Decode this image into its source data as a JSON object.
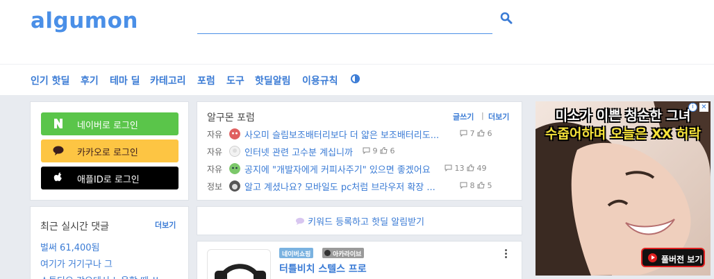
{
  "header": {
    "logo": "algumon",
    "search": {
      "placeholder": ""
    }
  },
  "nav": {
    "items": [
      "인기 핫딜",
      "후기",
      "테마 딜",
      "카테고리",
      "포럼",
      "도구",
      "핫딜알림",
      "이용규칙"
    ],
    "theme_toggle_icon": "contrast-icon"
  },
  "login": {
    "naver": {
      "label": "네이버로 로그인",
      "icon": "N",
      "color": "#5ac54a"
    },
    "kakao": {
      "label": "카카오로 로그인",
      "color": "#fdc543"
    },
    "apple": {
      "label": "애플ID로 로그인",
      "color": "#000000"
    }
  },
  "comments": {
    "title": "최근 실시간 댓글",
    "more": "더보기",
    "items": [
      "벌써 61,400됨",
      "여기가 거기구나 그"
    ]
  },
  "forum": {
    "title": "알구몬 포럼",
    "write": "글쓰기",
    "more": "더보기",
    "posts": [
      {
        "category": "자유",
        "title": "사오미 슬림보조배터리보다 더 얇은 보조배터리도...",
        "comments": "7",
        "likes": "6"
      },
      {
        "category": "자유",
        "title": "인터넷 관련 고수분 계십니까",
        "comments": "9",
        "likes": "6"
      },
      {
        "category": "자유",
        "title": "공지에 \"개발자에게 커피사주기\" 있으면 좋겠어요",
        "comments": "13",
        "likes": "49"
      },
      {
        "category": "정보",
        "title": "알고 계셨나요? 모바일도 pc처럼 브라우저 확장 ...",
        "comments": "8",
        "likes": "5"
      }
    ]
  },
  "keyword_banner": {
    "text": "키워드 등록하고 핫딜 알림받기"
  },
  "deal": {
    "tags": [
      "네이버쇼핑",
      "아카라이브"
    ],
    "title": "터틀비치 스텔스 프로"
  },
  "ad": {
    "headline_1": "미소가 이쁜 청순한 그녀",
    "headline_2": "수줍어하며 오늘은 XX 허락",
    "cta": "풀버전 보기"
  },
  "colors": {
    "accent": "#3a7bd5",
    "logo": "#4a8fe7",
    "background": "#e8ebf0"
  }
}
